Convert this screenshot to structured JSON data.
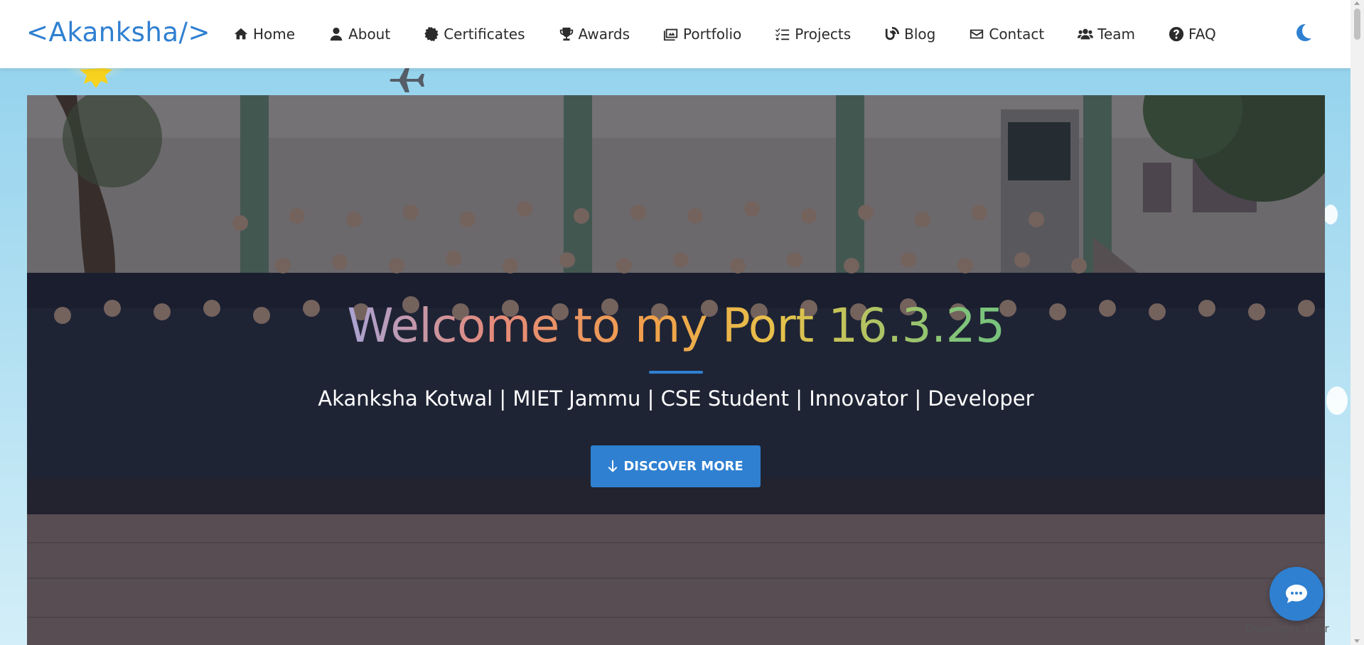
{
  "brand": "<Akanksha/>",
  "nav": {
    "items": [
      {
        "label": "Home",
        "icon": "home-icon"
      },
      {
        "label": "About",
        "icon": "user-icon"
      },
      {
        "label": "Certificates",
        "icon": "certificate-icon"
      },
      {
        "label": "Awards",
        "icon": "trophy-icon"
      },
      {
        "label": "Portfolio",
        "icon": "images-icon"
      },
      {
        "label": "Projects",
        "icon": "tasks-icon"
      },
      {
        "label": "Blog",
        "icon": "blog-icon"
      },
      {
        "label": "Contact",
        "icon": "envelope-icon"
      },
      {
        "label": "Team",
        "icon": "users-icon"
      },
      {
        "label": "FAQ",
        "icon": "question-circle-icon"
      }
    ],
    "theme_toggle_icon": "moon-icon"
  },
  "hero": {
    "title": "Welcome to my Port 16.3.25",
    "subtitle": "Akanksha Kotwal | MIET Jammu | CSE Student | Innovator | Developer",
    "cta_label": "DISCOVER MORE",
    "cta_icon": "arrow-down-icon"
  },
  "chat": {
    "icon": "chat-bubble-icon",
    "credit": "Developer Tahir"
  },
  "colors": {
    "accent": "#2f80d1",
    "sky": "#8fd0ec",
    "nav_text": "#2b2b2b"
  }
}
